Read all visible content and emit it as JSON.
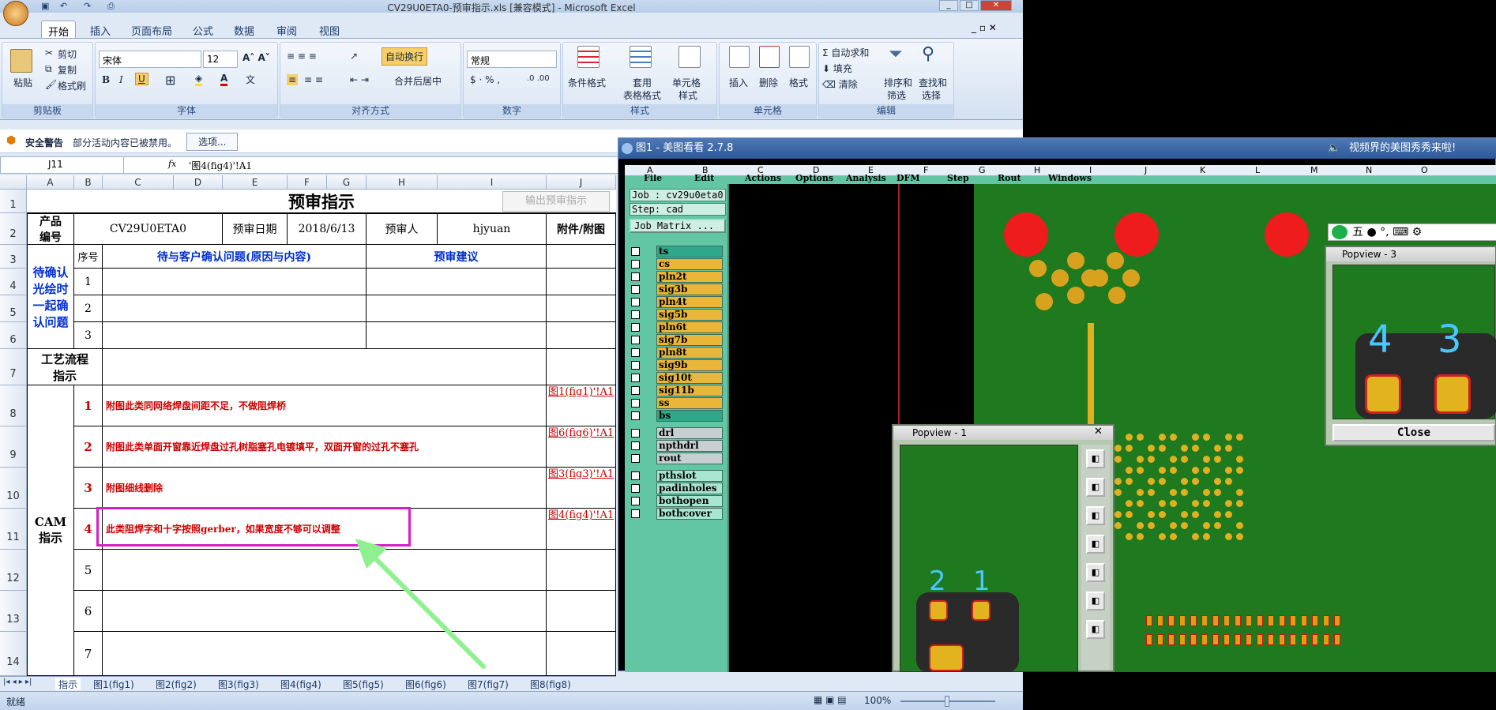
{
  "excel": {
    "title": "CV29U0ETA0-预审指示.xls  [兼容模式] - Microsoft Excel",
    "tabs": [
      "开始",
      "插入",
      "页面布局",
      "公式",
      "数据",
      "审阅",
      "视图"
    ],
    "clipboard": {
      "paste": "粘贴",
      "cut": "剪切",
      "copy": "复制",
      "format_painter": "格式刷",
      "label": "剪贴板"
    },
    "font": {
      "name": "宋体",
      "size": "12",
      "label": "字体"
    },
    "alignment": {
      "wrap": "自动换行",
      "merge": "合并后居中",
      "label": "对齐方式"
    },
    "number": {
      "format": "常规",
      "label": "数字"
    },
    "styles": {
      "cond": "条件格式",
      "table1": "套用",
      "table2": "表格格式",
      "cell1": "单元格",
      "cell2": "样式",
      "label": "样式"
    },
    "cells": {
      "insert": "插入",
      "delete": "删除",
      "format": "格式",
      "label": "单元格"
    },
    "editing": {
      "autosum": "自动求和",
      "fill": "填充",
      "clear": "清除",
      "sort1": "排序和",
      "sort2": "筛选",
      "find1": "查找和",
      "find2": "选择",
      "label": "编辑"
    },
    "security": {
      "title": "安全警告",
      "msg": "部分活动内容已被禁用。",
      "options": "选项..."
    },
    "namebox": "J11",
    "formula": "'图4(fig4)'!A1",
    "columns": [
      "A",
      "B",
      "C",
      "D",
      "E",
      "F",
      "G",
      "H",
      "I",
      "J"
    ],
    "rows": [
      "1",
      "2",
      "3",
      "4",
      "5",
      "6",
      "7",
      "8",
      "9",
      "10",
      "11",
      "12",
      "13",
      "14"
    ],
    "sheet": {
      "title": "预审指示",
      "export_btn": "输出预审指示",
      "product_label": "产品编号",
      "product": "CV29U0ETA0",
      "date_label": "预审日期",
      "date": "2018/6/13",
      "reviewer_label": "预审人",
      "reviewer": "hjyuan",
      "attach_label": "附件/附图",
      "pending_label": "待确认光绘时一起确认问题",
      "seq_label": "序号",
      "question_label": "待与客户确认问题(原因与内容)",
      "suggest_label": "预审建议",
      "pending_nums": [
        "1",
        "2",
        "3"
      ],
      "process_label": "工艺流程指示",
      "cam_label": "CAM指示",
      "cam_nums": [
        "1",
        "2",
        "3",
        "4",
        "5",
        "6",
        "7"
      ],
      "cam_items": [
        "附图此类同网络焊盘间距不足，不做阻焊桥",
        "附图此类单面开窗靠近焊盘过孔树脂塞孔电镀填平，双面开窗的过孔不塞孔",
        "附图细线删除",
        "此类阻焊字和十字按照gerber，如果宽度不够可以调整",
        "",
        "",
        ""
      ],
      "cam_links": [
        "图1(fig1)'!A1",
        "图6(fig6)'!A1",
        "图3(fig3)'!A1",
        "图4(fig4)'!A1",
        "",
        "",
        ""
      ]
    },
    "sheet_tabs": [
      "指示",
      "图1(fig1)",
      "图2(fig2)",
      "图3(fig3)",
      "图4(fig4)",
      "图5(fig5)",
      "图6(fig6)",
      "图7(fig7)",
      "图8(fig8)"
    ],
    "status": {
      "ready": "就绪",
      "zoom": "100%"
    }
  },
  "viewer": {
    "title": "图1 - 美图看看 2.7.8",
    "promo": "视频界的美图秀秀来啦!",
    "columns": [
      "A",
      "B",
      "C",
      "D",
      "E",
      "F",
      "G",
      "H",
      "I",
      "J",
      "K",
      "L",
      "M",
      "N",
      "O"
    ],
    "menu": [
      "File",
      "Edit",
      "Actions",
      "Options",
      "Analysis",
      "DFM",
      "Step",
      "Rout",
      "Windows"
    ],
    "job": "Job : cv29u0eta0",
    "step": "Step: cad",
    "job_matrix": "Job Matrix ...",
    "layers_signal": [
      "ts",
      "cs",
      "pln2t",
      "sig3b",
      "pln4t",
      "sig5b",
      "pln6t",
      "sig7b",
      "pln8t",
      "sig9b",
      "sig10t",
      "sig11b",
      "ss",
      "bs"
    ],
    "layers_drill": [
      "drl",
      "npthdrl",
      "rout"
    ],
    "layers_other": [
      "pthslot",
      "padinholes",
      "bothopen",
      "bothcover"
    ],
    "popview1": "Popview - 1",
    "popview3": "Popview - 3",
    "close": "Close",
    "pads_pop1": [
      "2",
      "1"
    ],
    "pads_pop3": [
      "4",
      "3"
    ],
    "ime": "五"
  }
}
